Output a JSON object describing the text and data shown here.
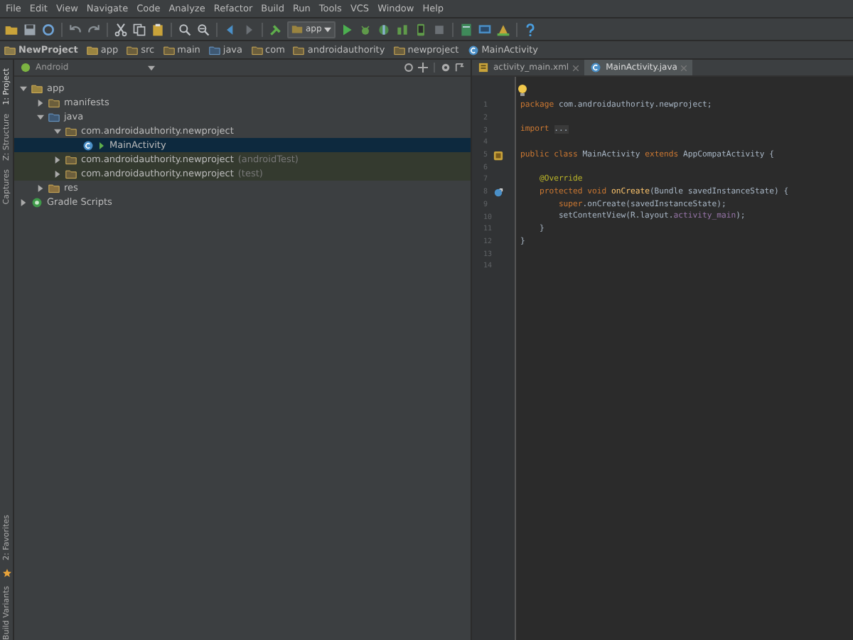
{
  "menu": [
    "File",
    "Edit",
    "View",
    "Navigate",
    "Code",
    "Analyze",
    "Refactor",
    "Build",
    "Run",
    "Tools",
    "VCS",
    "Window",
    "Help"
  ],
  "toolbar": {
    "run_config": "app"
  },
  "breadcrumbs": [
    {
      "label": "NewProject",
      "kind": "project"
    },
    {
      "label": "app",
      "kind": "module"
    },
    {
      "label": "src",
      "kind": "folder"
    },
    {
      "label": "main",
      "kind": "folder"
    },
    {
      "label": "java",
      "kind": "source"
    },
    {
      "label": "com",
      "kind": "folder"
    },
    {
      "label": "androidauthority",
      "kind": "folder"
    },
    {
      "label": "newproject",
      "kind": "folder"
    },
    {
      "label": "MainActivity",
      "kind": "class"
    }
  ],
  "side_tools_top": [
    "1: Project",
    "Z: Structure",
    "Captures"
  ],
  "side_tools_bottom": [
    "2: Favorites",
    "Build Variants"
  ],
  "project_view": {
    "mode": "Android",
    "tree": [
      {
        "label": "app",
        "kind": "module",
        "expanded": true,
        "selected": false,
        "children": [
          {
            "label": "manifests",
            "kind": "folder",
            "expanded": false,
            "selected": false
          },
          {
            "label": "java",
            "kind": "source",
            "expanded": true,
            "selected": false,
            "children": [
              {
                "label": "com.androidauthority.newproject",
                "kind": "package",
                "expanded": true,
                "selected": false,
                "children": [
                  {
                    "label": "MainActivity",
                    "kind": "class",
                    "selected": true
                  }
                ]
              },
              {
                "label": "com.androidauthority.newproject",
                "suffix": "(androidTest)",
                "kind": "test-package",
                "expanded": false,
                "selected": false
              },
              {
                "label": "com.androidauthority.newproject",
                "suffix": "(test)",
                "kind": "test-package",
                "expanded": false,
                "selected": false
              }
            ]
          },
          {
            "label": "res",
            "kind": "res",
            "expanded": false,
            "selected": false
          }
        ]
      },
      {
        "label": "Gradle Scripts",
        "kind": "gradle",
        "expanded": false,
        "selected": false
      }
    ]
  },
  "editor_tabs": [
    {
      "label": "activity_main.xml",
      "kind": "xml",
      "selected": false
    },
    {
      "label": "MainActivity.java",
      "kind": "class",
      "selected": true
    }
  ],
  "code": [
    {
      "number": "1",
      "kind": "plain",
      "tokens": [
        {
          "kind": "keyword",
          "text": "package"
        },
        {
          "kind": "plain",
          "text": " com.androidauthority.newproject;"
        }
      ]
    },
    {
      "number": "2",
      "kind": "plain"
    },
    {
      "number": "3",
      "kind": "plain",
      "tokens": [
        {
          "kind": "keyword",
          "text": "import"
        },
        {
          "kind": "folded",
          "text": "..."
        }
      ]
    },
    {
      "number": "4",
      "kind": "plain"
    },
    {
      "number": "5",
      "kind": "implements",
      "tokens": [
        {
          "kind": "keyword",
          "text": "public class"
        },
        {
          "kind": "plain",
          "text": " MainActivity "
        },
        {
          "kind": "keyword",
          "text": "extends"
        },
        {
          "kind": "plain",
          "text": " AppCompatActivity {"
        }
      ]
    },
    {
      "number": "6",
      "kind": "plain"
    },
    {
      "number": "7",
      "kind": "plain",
      "tokens": [
        {
          "kind": "annotation",
          "text": "    @Override"
        }
      ]
    },
    {
      "number": "8",
      "kind": "overrides",
      "tokens": [
        {
          "kind": "keyword",
          "text": "    protected void"
        },
        {
          "kind": "method",
          "text": " onCreate"
        },
        {
          "kind": "plain",
          "text": "(Bundle savedInstanceState) {"
        }
      ]
    },
    {
      "number": "9",
      "kind": "plain",
      "tokens": [
        {
          "kind": "keyword",
          "text": "        super"
        },
        {
          "kind": "plain",
          "text": ".onCreate(savedInstanceState);"
        }
      ]
    },
    {
      "number": "10",
      "kind": "plain",
      "tokens": [
        {
          "kind": "plain",
          "text": "        setContentView(R.layout."
        },
        {
          "kind": "field",
          "text": "activity_main"
        },
        {
          "kind": "plain",
          "text": ");"
        }
      ]
    },
    {
      "number": "11",
      "kind": "plain",
      "tokens": [
        {
          "kind": "plain",
          "text": "    }"
        }
      ]
    },
    {
      "number": "12",
      "kind": "plain",
      "tokens": [
        {
          "kind": "plain",
          "text": "}"
        }
      ]
    },
    {
      "number": "13",
      "kind": "plain"
    },
    {
      "number": "14",
      "kind": "plain"
    }
  ]
}
